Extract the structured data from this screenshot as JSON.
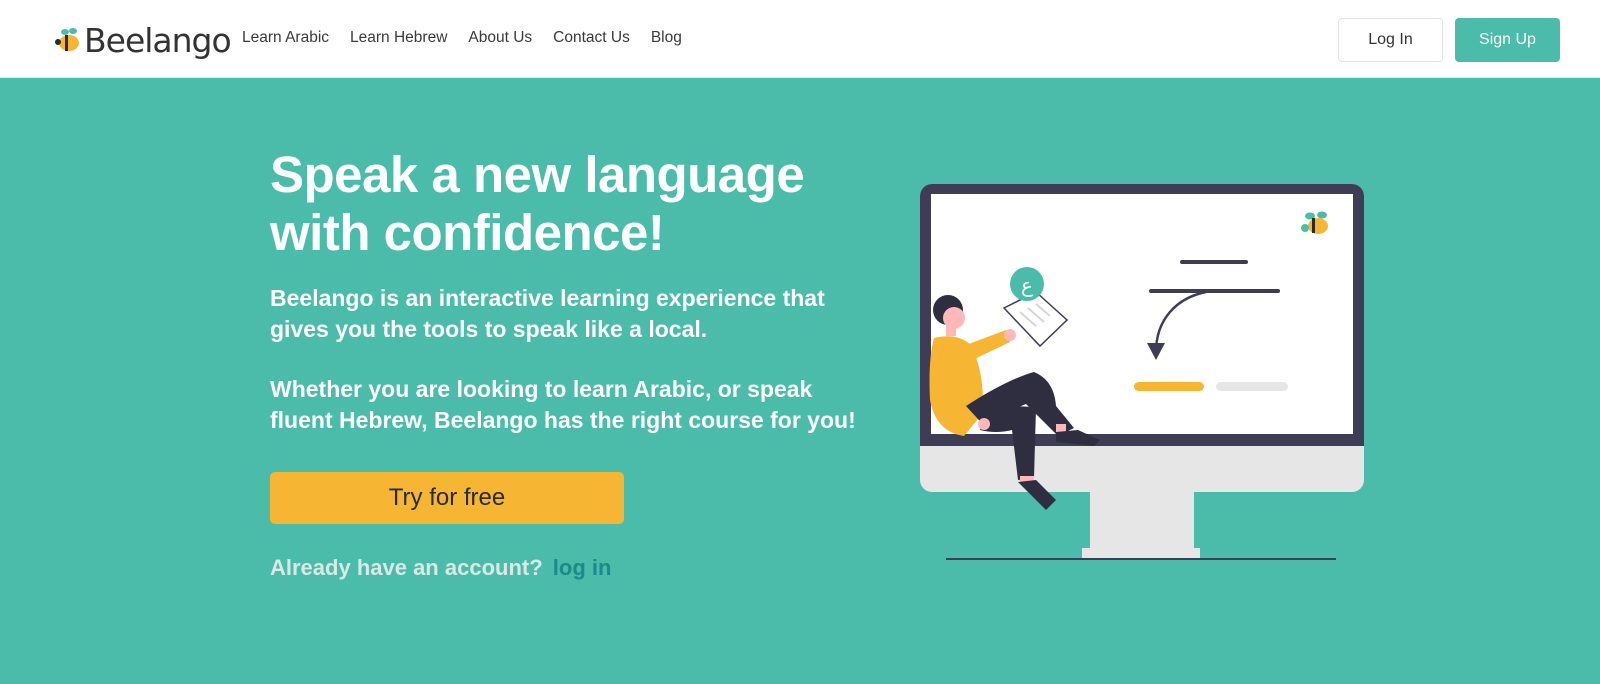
{
  "brand": {
    "name": "Beelango"
  },
  "nav": {
    "links": [
      {
        "label": "Learn Arabic"
      },
      {
        "label": "Learn Hebrew"
      },
      {
        "label": "About Us"
      },
      {
        "label": "Contact Us"
      },
      {
        "label": "Blog"
      }
    ],
    "login_label": "Log In",
    "signup_label": "Sign Up"
  },
  "hero": {
    "title_line1": "Speak a new language",
    "title_line2": "with confidence!",
    "desc1_line1": "Beelango is an interactive learning experience that",
    "desc1_line2": "gives you the tools to speak like a local.",
    "desc2_line1": "Whether you are looking to learn Arabic, or speak",
    "desc2_line2": "fluent Hebrew, Beelango has the right course for you!",
    "cta_label": "Try for free",
    "already_text": "Already have an account?",
    "login_link": "log in"
  },
  "illustration": {
    "card_glyph": "ع"
  },
  "colors": {
    "accent": "#4bbcaa",
    "cta": "#f6b633",
    "link": "#1a8a8a"
  }
}
